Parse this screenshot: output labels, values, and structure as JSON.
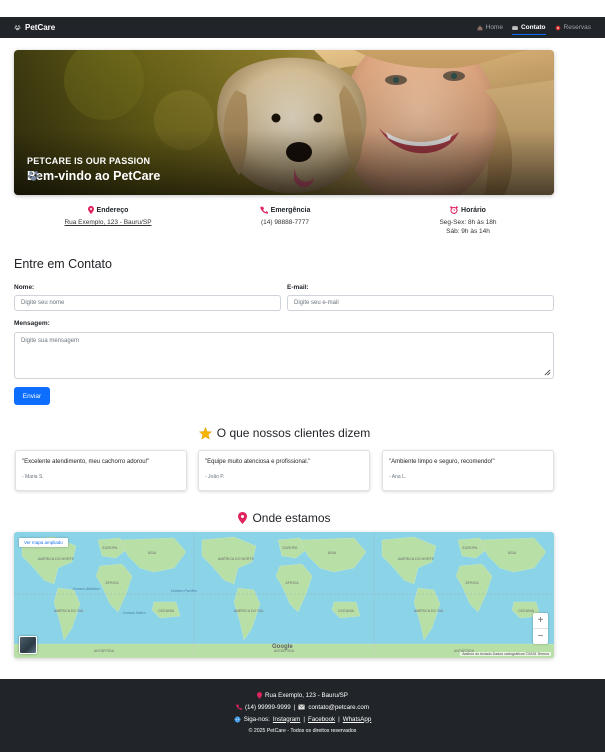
{
  "nav": {
    "brand": "PetCare",
    "items": [
      {
        "label": "Home",
        "icon": "house-icon"
      },
      {
        "label": "Contato",
        "icon": "envelope-icon"
      },
      {
        "label": "Reservas",
        "icon": "calendar-icon"
      }
    ]
  },
  "hero": {
    "subtitle": "PETCARE IS OUR PASSION",
    "title": "Bem-vindo ao PetCare"
  },
  "info": {
    "address": {
      "label": "Endereço",
      "link": "Rua Exemplo, 123 - Bauru/SP",
      "icon": "map-pin-icon"
    },
    "emergency": {
      "label": "Emergência",
      "phone": "(14) 98888-7777",
      "icon": "phone-icon"
    },
    "hours": {
      "label": "Horário",
      "line1": "Seg-Sex: 8h às 18h",
      "line2": "Sáb: 9h às 14h",
      "icon": "alarm-clock-icon"
    }
  },
  "contact": {
    "title": "Entre em Contato",
    "name_label": "Nome:",
    "name_placeholder": "Digite seu nome",
    "email_label": "E-mail:",
    "email_placeholder": "Digite seu e-mail",
    "message_label": "Mensagem:",
    "message_placeholder": "Digite sua mensagem",
    "submit": "Enviar"
  },
  "testimonials": {
    "title": "O que nossos clientes dizem",
    "icon": "star-icon",
    "items": [
      {
        "quote": "\"Excelente atendimento, meu cachorro adorou!\"",
        "author": "- Maria S."
      },
      {
        "quote": "\"Equipe muito atenciosa e profissional.\"",
        "author": "- João P."
      },
      {
        "quote": "\"Ambiente limpo e seguro, recomendo!\"",
        "author": "- Ana L."
      }
    ]
  },
  "map": {
    "title": "Onde estamos",
    "icon": "map-pin-icon",
    "view_larger": "Ver mapa ampliado",
    "zoom_in": "+",
    "zoom_out": "−",
    "google": "Google",
    "attribution": "Atalhos do teclado   Dados cartográficos ©2025   Termos",
    "labels": {
      "na": "AMÉRICA DO NORTE",
      "sa": "AMÉRICA DO SUL",
      "eu": "EUROPA",
      "af": "ÁFRICA",
      "asia": "ÁSIA",
      "oc": "OCEANIA",
      "ant": "ANTÁRTIDA",
      "pac": "Oceano Pacífico",
      "atl": "Oceano Atlântico",
      "ind": "Oceano Índico"
    }
  },
  "footer": {
    "address": "Rua Exemplo, 123 - Bauru/SP",
    "phone": "(14) 99999-9999",
    "email": "contato@petcare.com",
    "follow": "Siga-nos:",
    "instagram": "Instagram",
    "facebook": "Facebook",
    "whatsapp": "WhatsApp",
    "sep": "|",
    "copyright": "© 2025 PetCare - Todos os direitos reservados"
  },
  "colors": {
    "navbar": "#212529",
    "primary": "#0d6efd",
    "footer": "#212529",
    "pin": "#e0245e"
  }
}
